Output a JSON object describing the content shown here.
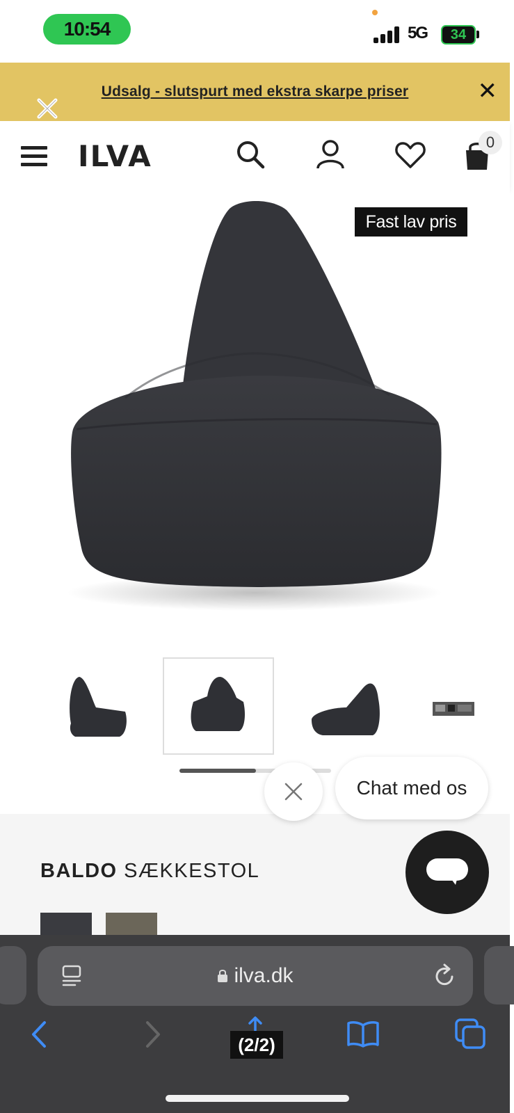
{
  "status_bar": {
    "time": "10:54",
    "network": "5G",
    "battery": "34",
    "signal_bars": 4,
    "accent_color": "#2fc653"
  },
  "banner": {
    "text": "Udsalg - slutspurt med ekstra skarpe priser",
    "close_icon": "close-icon",
    "background_color": "#e2c463"
  },
  "header": {
    "logo": "ILVA",
    "icons": [
      "menu-icon",
      "search-icon",
      "account-icon",
      "heart-icon",
      "bag-icon"
    ],
    "cart_count": "0"
  },
  "product": {
    "price_badge": "Fast lav pris",
    "brand": "BALDO",
    "name": "SÆKKESTOL",
    "thumbnail_count": 4,
    "active_thumbnail": 2,
    "swatches": [
      "#3a3b40",
      "#6b6659"
    ]
  },
  "chat": {
    "label": "Chat med os",
    "close_icon": "close-icon",
    "launcher_icon": "chat-icon"
  },
  "browser": {
    "url": "ilva.dk",
    "page_counter": "(2/2)",
    "icons": [
      "back-icon",
      "forward-icon",
      "share-icon",
      "bookmarks-icon",
      "tabs-icon"
    ]
  }
}
